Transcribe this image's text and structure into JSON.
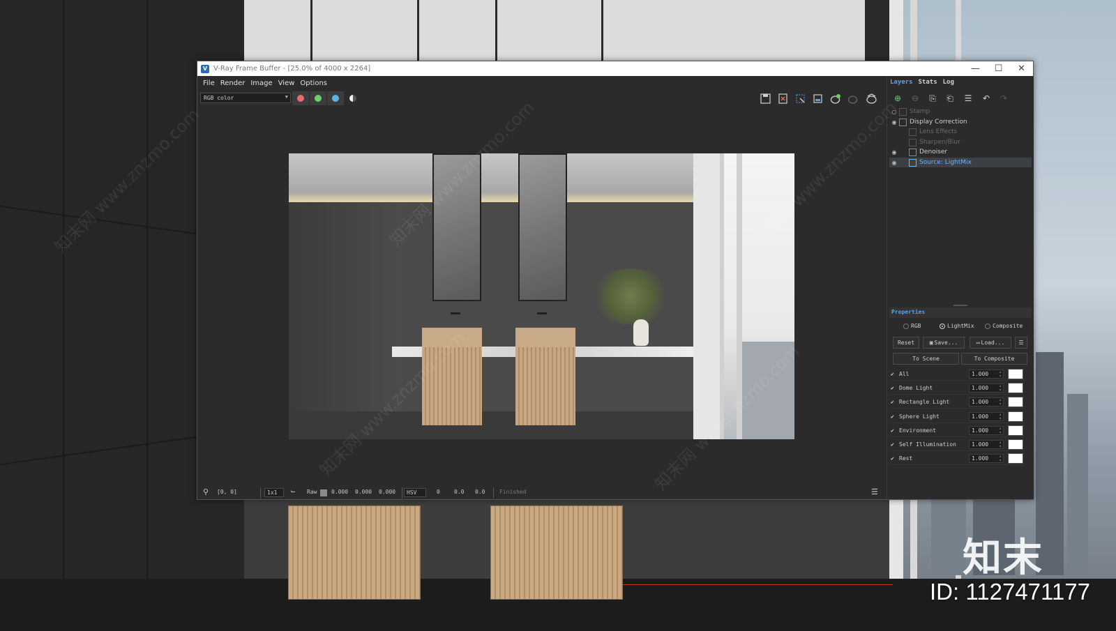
{
  "window": {
    "title": "V-Ray Frame Buffer - [25.0% of 4000 x 2264]",
    "minimize": "—",
    "maximize": "☐",
    "close": "✕"
  },
  "menu": [
    "File",
    "Render",
    "Image",
    "View",
    "Options"
  ],
  "toolbar": {
    "channel": "RGB color",
    "channel_colors": {
      "red": "#e86b6b",
      "green": "#6ccf6c",
      "blue": "#5ab4e6"
    },
    "icons": [
      "save-icon",
      "clear-icon",
      "region-icon",
      "track-mouse-icon",
      "render-icon",
      "stop-icon",
      "render-interactive-icon"
    ]
  },
  "status": {
    "coords": "[0, 0]",
    "zoom": "1x1",
    "raw_label": "Raw",
    "rgb": [
      "0.000",
      "0.000",
      "0.000"
    ],
    "color_space": "HSV",
    "hsv": [
      "0",
      "0.0",
      "0.0"
    ],
    "state": "Finished"
  },
  "side_tabs": [
    "Layers",
    "Stats",
    "Log"
  ],
  "layers": [
    {
      "name": "Stamp",
      "enabled": false,
      "selected": false
    },
    {
      "name": "Display Correction",
      "enabled": true,
      "selected": false
    },
    {
      "name": "Lens Effects",
      "enabled": false,
      "selected": false
    },
    {
      "name": "Sharpen/Blur",
      "enabled": false,
      "selected": false
    },
    {
      "name": "Denoiser",
      "enabled": true,
      "selected": false
    },
    {
      "name": "Source: LightMix",
      "enabled": true,
      "selected": true
    }
  ],
  "properties": {
    "header": "Properties",
    "modes": [
      "RGB",
      "LightMix",
      "Composite"
    ],
    "selected_mode": "LightMix",
    "reset": "Reset",
    "save": "Save...",
    "load": "Load...",
    "to_scene": "To Scene",
    "to_composite": "To Composite",
    "lights": [
      {
        "name": "All",
        "value": "1.000",
        "color": "#ffffff"
      },
      {
        "name": "Dome Light",
        "value": "1.000",
        "color": "#ffffff"
      },
      {
        "name": "Rectangle Light",
        "value": "1.000",
        "color": "#ffffff"
      },
      {
        "name": "Sphere Light",
        "value": "1.000",
        "color": "#ffffff"
      },
      {
        "name": "Environment",
        "value": "1.000",
        "color": "#ffffff"
      },
      {
        "name": "Self Illumination",
        "value": "1.000",
        "color": "#ffffff"
      },
      {
        "name": "Rest",
        "value": "1.000",
        "color": "#ffffff"
      }
    ]
  },
  "brand": {
    "logo_text": "知末",
    "id": "ID: 1127471177",
    "watermark": "知末网 www.znzmo.com"
  }
}
